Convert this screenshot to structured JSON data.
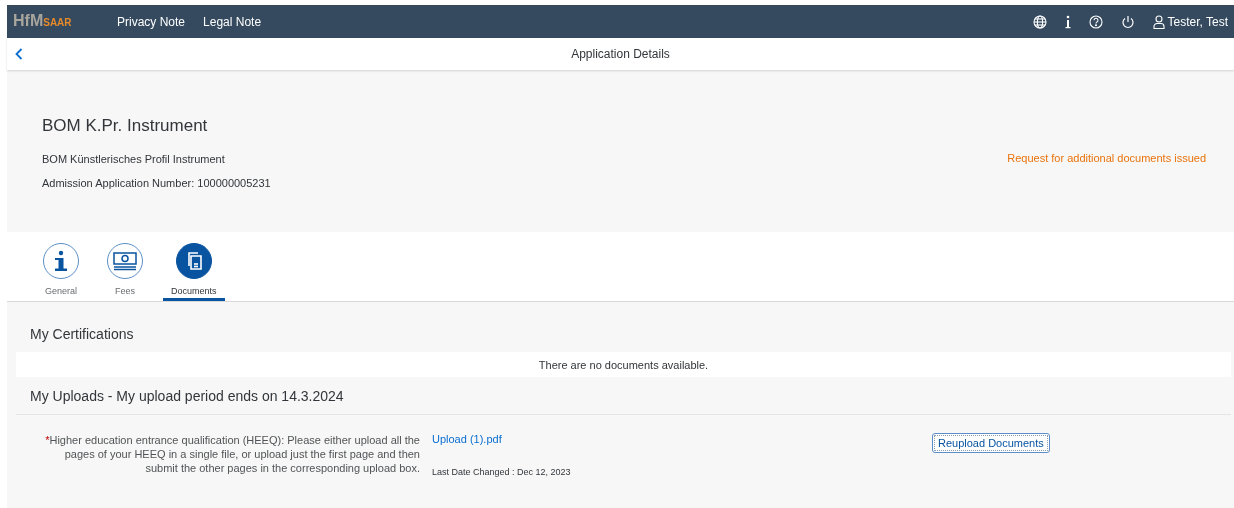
{
  "shell": {
    "logo": {
      "main": "HfM",
      "accent": "SAAR"
    },
    "links": [
      "Privacy Note",
      "Legal Note"
    ],
    "actions": [
      {
        "kind": "globe"
      },
      {
        "kind": "info"
      },
      {
        "kind": "help"
      },
      {
        "kind": "power"
      }
    ],
    "user": "Tester, Test"
  },
  "page_title": "Application Details",
  "object": {
    "title": "BOM K.Pr. Instrument",
    "subtitle": "BOM Künstlerisches Profil Instrument",
    "number": "Admission Application Number: 100000005231",
    "status": "Request for additional documents issued"
  },
  "tabs": [
    {
      "label": "General",
      "kind": "info",
      "selected": false
    },
    {
      "label": "Fees",
      "kind": "money",
      "selected": false
    },
    {
      "label": "Documents",
      "kind": "document",
      "selected": true
    }
  ],
  "sections": [
    {
      "title": "My Certifications",
      "empty_text": "There are no documents available."
    },
    {
      "title": "My Uploads - My upload period ends on 14.3.2024",
      "uploads": [
        {
          "required_mark": "*",
          "label": "Higher education entrance qualification (HEEQ): Please either upload all the pages of your HEEQ in a single file, or upload just the first page and then submit the other pages in the corresponding upload box.",
          "file": "Upload (1).pdf",
          "changed": "Last Date Changed : Dec 12, 2023",
          "button": "Reupload Documents"
        }
      ]
    }
  ]
}
